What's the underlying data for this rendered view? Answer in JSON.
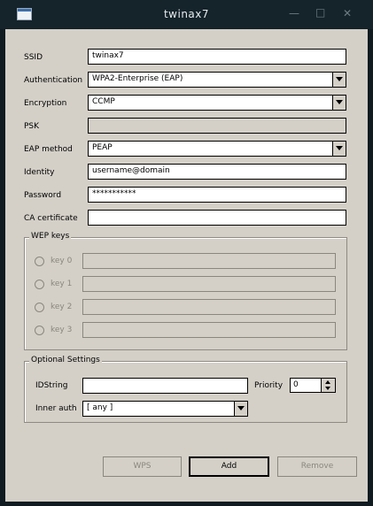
{
  "window": {
    "title": "twinax7"
  },
  "form": {
    "ssid": {
      "label": "SSID",
      "value": "twinax7"
    },
    "authentication": {
      "label": "Authentication",
      "value": "WPA2-Enterprise (EAP)"
    },
    "encryption": {
      "label": "Encryption",
      "value": "CCMP"
    },
    "psk": {
      "label": "PSK",
      "value": ""
    },
    "eap_method": {
      "label": "EAP method",
      "value": "PEAP"
    },
    "identity": {
      "label": "Identity",
      "value": "username@domain"
    },
    "password": {
      "label": "Password",
      "value": "***********"
    },
    "ca_certificate": {
      "label": "CA certificate",
      "value": ""
    }
  },
  "wep": {
    "title": "WEP keys",
    "keys": [
      {
        "label": "key 0",
        "value": ""
      },
      {
        "label": "key 1",
        "value": ""
      },
      {
        "label": "key 2",
        "value": ""
      },
      {
        "label": "key 3",
        "value": ""
      }
    ]
  },
  "optional": {
    "title": "Optional Settings",
    "idstring_label": "IDString",
    "idstring_value": "",
    "priority_label": "Priority",
    "priority_value": "0",
    "inner_auth_label": "Inner auth",
    "inner_auth_value": "[ any ]"
  },
  "buttons": {
    "wps": "WPS",
    "add": "Add",
    "remove": "Remove"
  }
}
